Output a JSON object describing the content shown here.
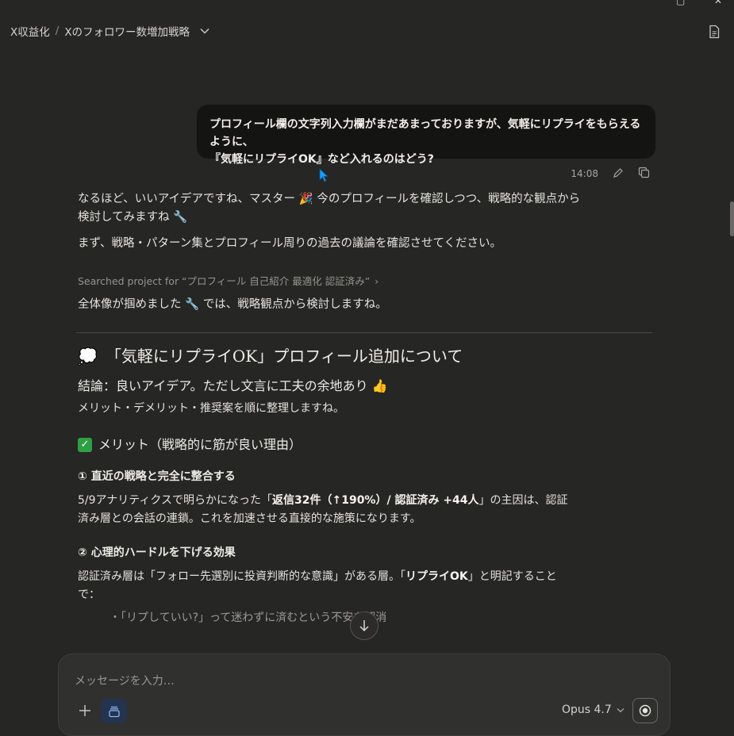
{
  "window": {
    "restore_glyph": "▢",
    "close_glyph": "✕"
  },
  "breadcrumb": {
    "project": "X収益化",
    "separator": "/",
    "chat_title": "Xのフォロワー数増加戦略"
  },
  "user_message": {
    "line1": "プロフィール欄の文字列入力欄がまだあまっておりますが、気軽にリプライをもらえるように、",
    "line2": "『気軽にリプライOK』など入れるのはどう?",
    "time": "14:08"
  },
  "assistant": {
    "p1_line1": "なるほど、いいアイデアですね、マスター 🎉 今のプロフィールを確認しつつ、戦略的な観点から",
    "p1_line2": "検討してみますね 🔧",
    "p2": "まず、戦略・パターン集とプロフィール周りの過去の議論を確認させてください。",
    "searched": "Searched project for “プロフィール 自己紹介 最適化 認証済み”",
    "searched_chevron": "›",
    "p3": "全体像が掴めました 🔧 では、戦略観点から検討しますね。",
    "h2_emoji": "💭",
    "h2": "「気軽にリプライOK」プロフィール追加について",
    "h3": "結論：良いアイデア。ただし文言に工夫の余地あり 👍",
    "sub": "メリット・デメリット・推奨案を順に整理しますね。",
    "h4_check": "✓",
    "h4": "メリット（戦略的に筋が良い理由）",
    "item1_title": "① 直近の戦略と完全に整合する",
    "item1_a": "5/9アナリティクスで明らかになった「",
    "item1_b": "返信32件（↑190%）/ 認証済み +44人",
    "item1_c": "」の主因は、認証",
    "item1_d": "済み層との会話の連鎖。これを加速させる直接的な施策になります。",
    "item2_title": "② 心理的ハードルを下げる効果",
    "item2_a": "認証済み層は「フォロー先選別に投資判断的な意識」がある層。「",
    "item2_b": "リプライOK",
    "item2_c": "」と明記すること",
    "item2_d": "で：",
    "cut_line": "・「リプしていい?」って迷わずに済むという不安を解消"
  },
  "composer": {
    "placeholder": "メッセージを入力…",
    "model": "Opus 4.7"
  },
  "colors": {
    "background": "#262624",
    "user_bubble": "#141413",
    "accent_project": "#24344f",
    "check_green": "#2ea043",
    "cursor_blue": "#1a9cff"
  }
}
